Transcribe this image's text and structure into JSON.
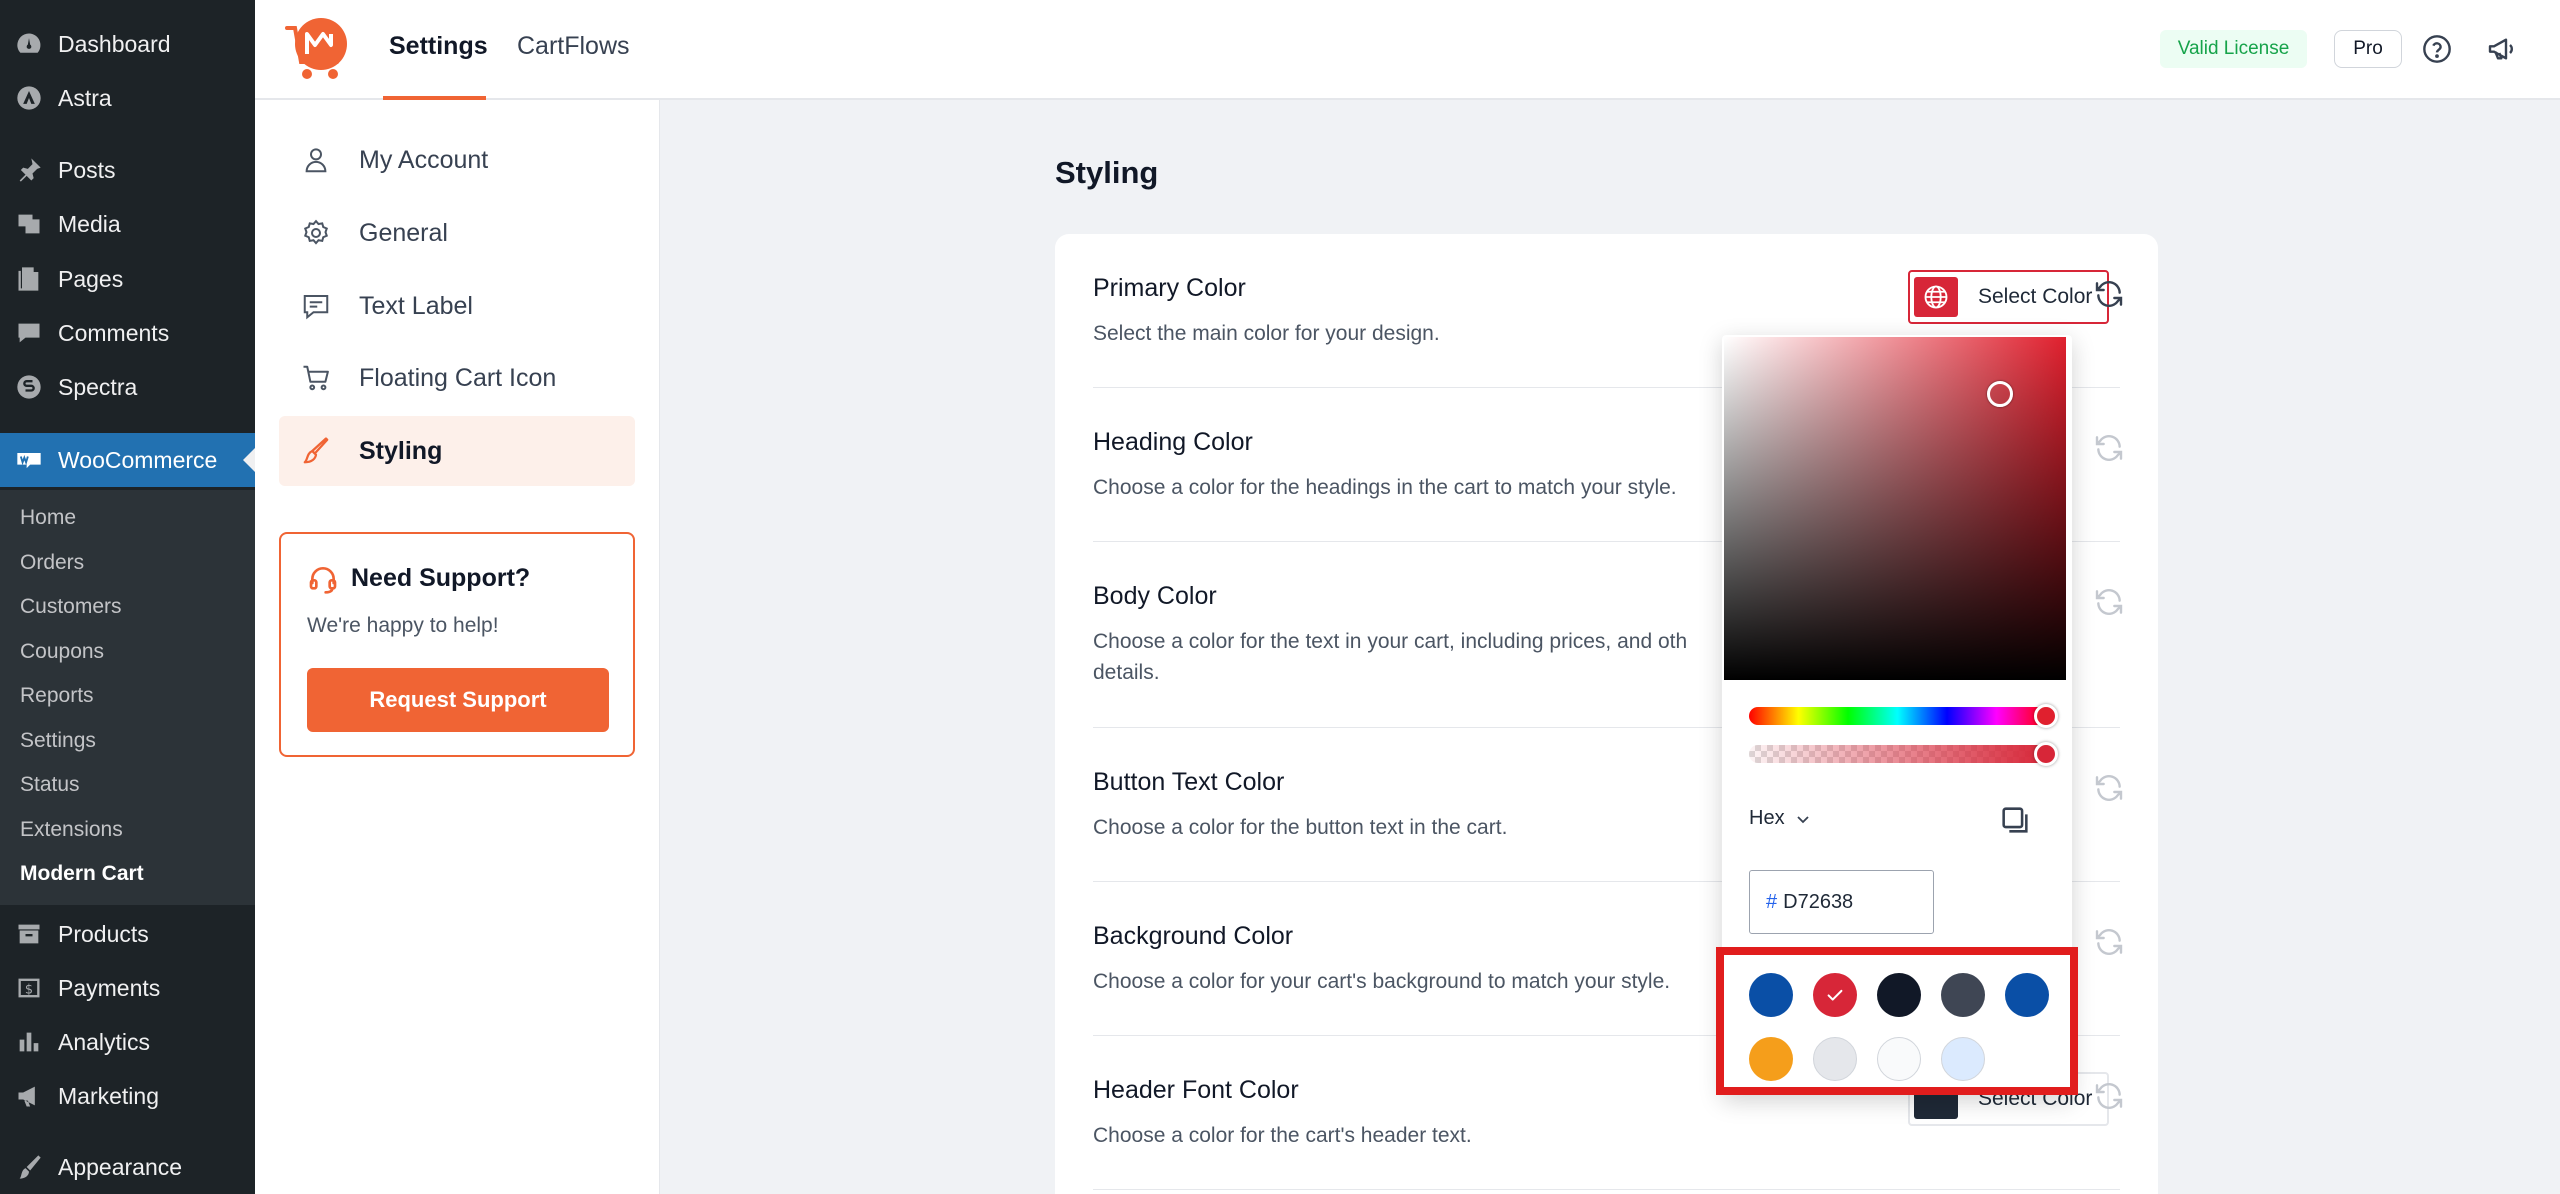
{
  "wp_menu": {
    "items": [
      {
        "label": "Dashboard",
        "icon": "dashboard-icon"
      },
      {
        "label": "Astra",
        "icon": "astra-icon"
      },
      {
        "label": "Posts",
        "icon": "pin-icon"
      },
      {
        "label": "Media",
        "icon": "media-icon"
      },
      {
        "label": "Pages",
        "icon": "pages-icon"
      },
      {
        "label": "Comments",
        "icon": "comment-icon"
      },
      {
        "label": "Spectra",
        "icon": "spectra-icon"
      },
      {
        "label": "WooCommerce",
        "icon": "woocommerce-icon"
      },
      {
        "label": "Products",
        "icon": "archive-icon"
      },
      {
        "label": "Payments",
        "icon": "dollar-icon"
      },
      {
        "label": "Analytics",
        "icon": "bar-chart-icon"
      },
      {
        "label": "Marketing",
        "icon": "megaphone-icon"
      },
      {
        "label": "Appearance",
        "icon": "brush-icon"
      }
    ],
    "submenu": [
      "Home",
      "Orders",
      "Customers",
      "Coupons",
      "Reports",
      "Settings",
      "Status",
      "Extensions",
      "Modern Cart"
    ]
  },
  "header": {
    "tabs": [
      "Settings",
      "CartFlows"
    ],
    "license_label": "Valid License",
    "pro_label": "Pro"
  },
  "settings_nav": {
    "items": [
      {
        "label": "My Account",
        "icon": "user-icon"
      },
      {
        "label": "General",
        "icon": "gear-icon"
      },
      {
        "label": "Text Label",
        "icon": "message-icon"
      },
      {
        "label": "Floating Cart Icon",
        "icon": "cart-icon"
      },
      {
        "label": "Styling",
        "icon": "paintbrush-icon"
      }
    ],
    "support": {
      "title": "Need Support?",
      "text": "We're happy to help!",
      "button": "Request Support"
    }
  },
  "main": {
    "title": "Styling",
    "rows": [
      {
        "title": "Primary Color",
        "desc": "Select the main color for your design."
      },
      {
        "title": "Heading Color",
        "desc": "Choose a color for the headings in the cart to match your style."
      },
      {
        "title": "Body Color",
        "desc": "Choose a color for the text in your cart, including prices, and oth details."
      },
      {
        "title": "Button Text Color",
        "desc": "Choose a color for the button text in the cart."
      },
      {
        "title": "Background Color",
        "desc": "Choose a color for your cart's background to match your style."
      },
      {
        "title": "Header Font Color",
        "desc": "Choose a color for the cart's header text."
      }
    ],
    "select_color_label": "Select Color"
  },
  "picker": {
    "format": "Hex",
    "hash": "#",
    "hex_value": "D72638",
    "palette": [
      {
        "color": "#0a4fa6",
        "selected": false
      },
      {
        "color": "#d72638",
        "selected": true
      },
      {
        "color": "#111827",
        "selected": false
      },
      {
        "color": "#3f4654",
        "selected": false
      },
      {
        "color": "#0a4fa6",
        "selected": false
      },
      {
        "color": "#f59e1b",
        "selected": false
      },
      {
        "color": "#e5e7eb",
        "selected": false
      },
      {
        "color": "#f9fafb",
        "selected": false
      },
      {
        "color": "#dbeafe",
        "selected": false
      }
    ]
  },
  "colors": {
    "accent": "#f06434",
    "primary_selected": "#d72638",
    "wp_blue": "#2271b1"
  }
}
